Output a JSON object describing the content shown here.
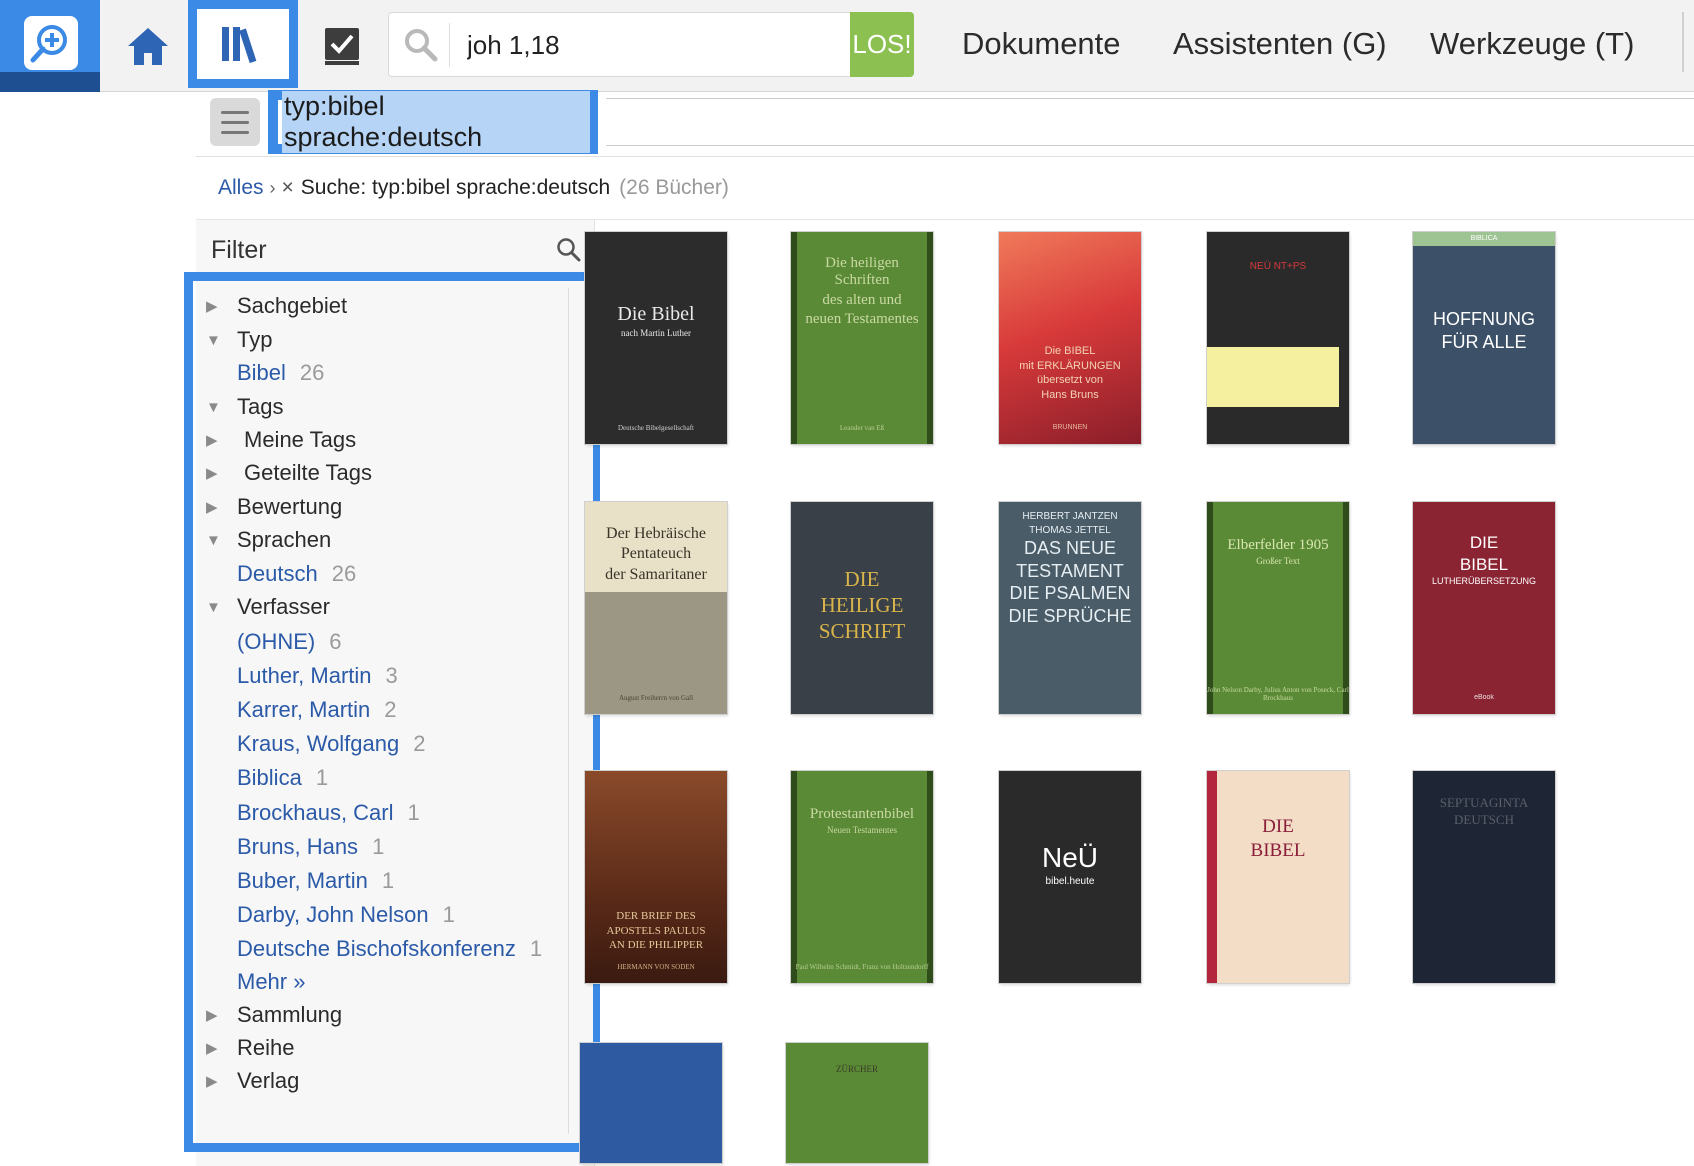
{
  "search": {
    "value": "joh 1,18",
    "go_label": "LOS!"
  },
  "menu": {
    "documents": "Dokumente",
    "assistants": "Assistenten (G)",
    "tools": "Werkzeuge (T)"
  },
  "query": {
    "text": "typ:bibel sprache:deutsch"
  },
  "breadcrumb": {
    "all": "Alles",
    "separator": "›",
    "remove": "×",
    "search_label": "Suche: typ:bibel sprache:deutsch",
    "count": "(26 Bücher)"
  },
  "filter": {
    "title": "Filter",
    "rows": [
      {
        "label": "Sachgebiet",
        "tri": "▶"
      },
      {
        "label": "Typ",
        "tri": "▼"
      },
      {
        "label": "Bibel",
        "count": "26"
      },
      {
        "label": "Tags",
        "tri": "▼"
      },
      {
        "label": "Meine Tags",
        "tri": "▶"
      },
      {
        "label": "Geteilte Tags",
        "tri": "▶"
      },
      {
        "label": "Bewertung",
        "tri": "▶"
      },
      {
        "label": "Sprachen",
        "tri": "▼"
      },
      {
        "label": "Deutsch",
        "count": "26"
      },
      {
        "label": "Verfasser",
        "tri": "▼"
      },
      {
        "label": "(OHNE)",
        "count": "6"
      },
      {
        "label": "Luther, Martin",
        "count": "3"
      },
      {
        "label": "Karrer, Martin",
        "count": "2"
      },
      {
        "label": "Kraus, Wolfgang",
        "count": "2"
      },
      {
        "label": "Biblica",
        "count": "1"
      },
      {
        "label": "Brockhaus, Carl",
        "count": "1"
      },
      {
        "label": "Bruns, Hans",
        "count": "1"
      },
      {
        "label": "Buber, Martin",
        "count": "1"
      },
      {
        "label": "Darby, John Nelson",
        "count": "1"
      },
      {
        "label": "Deutsche Bischofskonferenz",
        "count": "1"
      },
      {
        "label": "Mehr »"
      },
      {
        "label": "Sammlung",
        "tri": "▶"
      },
      {
        "label": "Reihe",
        "tri": "▶"
      },
      {
        "label": "Verlag",
        "tri": "▶"
      }
    ]
  },
  "books": [
    {
      "lines": [
        "Die Bibel",
        "nach Martin Luther"
      ],
      "footer": "Deutsche Bibelgesellschaft",
      "color": "#2c2c2c"
    },
    {
      "lines": [
        "Die heiligen Schriften",
        "des alten und",
        "neuen Testamentes"
      ],
      "footer": "Leander van Eß",
      "color": "#4e7a2e"
    },
    {
      "lines": [
        "Die BIBEL",
        "mit ERKLÄRUNGEN",
        "übersetzt von",
        "Hans Bruns"
      ],
      "footer": "BRUNNEN",
      "color": "#c8322e"
    },
    {
      "lines": [
        "NEÜ NT+PS"
      ],
      "footer": "",
      "color": "#2a2a2a"
    },
    {
      "lines": [
        "BIBLICA",
        "HOFFNUNG",
        "FÜR ALLE"
      ],
      "footer": "",
      "color": "#3c5068"
    },
    {
      "lines": [
        "Der Hebräische",
        "Pentateuch",
        "der Samaritaner"
      ],
      "footer": "August Freiherrn von Gall",
      "color": "#b9b39e"
    },
    {
      "lines": [
        "DIE",
        "HEILIGE",
        "SCHRIFT"
      ],
      "footer": "",
      "color": "#3a4048"
    },
    {
      "lines": [
        "HERBERT JANTZEN",
        "THOMAS JETTEL",
        "DAS NEUE",
        "TESTAMENT",
        "DIE PSALMEN",
        "DIE SPRÜCHE"
      ],
      "footer": "",
      "color": "#4a5c68"
    },
    {
      "lines": [
        "Elberfelder 1905",
        "Großer Text"
      ],
      "footer": "John Nelson Darby, Julius Anton von Poseck, Carl Brockhaus",
      "color": "#4e7a2e"
    },
    {
      "lines": [
        "DIE",
        "BIBEL",
        "LUTHERÜBERSETZUNG"
      ],
      "footer": "eBook",
      "color": "#8a2332"
    },
    {
      "lines": [
        "DER BRIEF DES",
        "APOSTELS PAULUS",
        "AN DIE PHILIPPER"
      ],
      "footer": "HERMANN VON SODEN",
      "color": "#6b3a22"
    },
    {
      "lines": [
        "Protestantenbibel",
        "Neuen Testamentes"
      ],
      "footer": "Paul Wilhelm Schmidt, Franz von Holtzendorff",
      "color": "#4e7a2e"
    },
    {
      "lines": [
        "NeÜ",
        "bibel.heute"
      ],
      "footer": "",
      "color": "#2a2a2a"
    },
    {
      "lines": [
        "DIE",
        "BIBEL"
      ],
      "footer": "",
      "color": "#f2dcc6"
    },
    {
      "lines": [
        "SEPTUAGINTA",
        "DEUTSCH"
      ],
      "footer": "",
      "color": "#1e2535"
    },
    {
      "lines": [],
      "footer": "",
      "color": "#2d5aa0"
    },
    {
      "lines": [
        "ZÜRCHER"
      ],
      "footer": "",
      "color": "#5a8a36"
    }
  ]
}
